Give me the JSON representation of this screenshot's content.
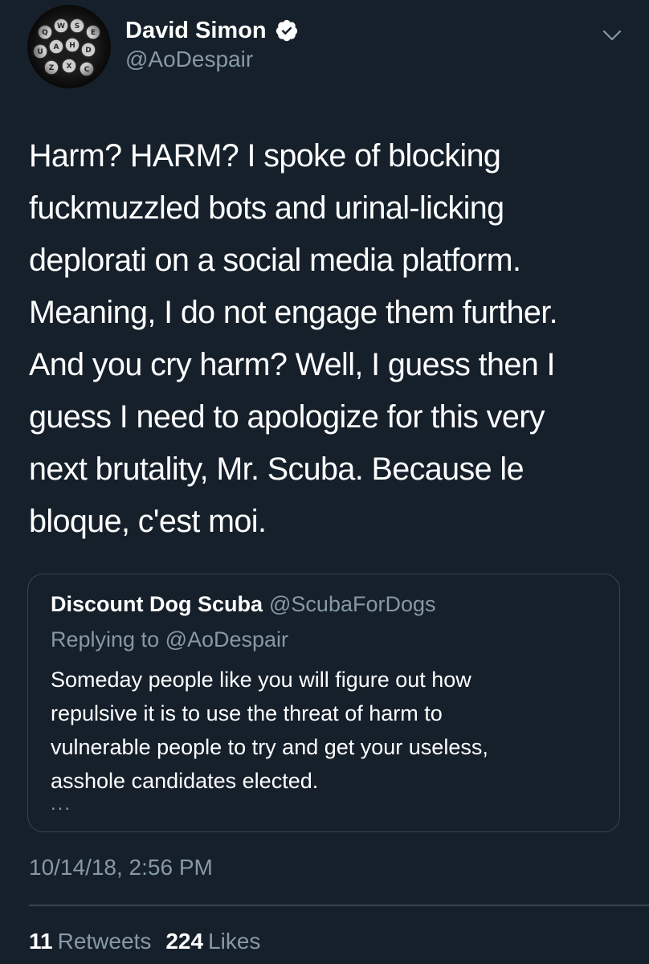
{
  "author": {
    "name": "David Simon",
    "handle": "@AoDespair",
    "verified": true,
    "avatar_icon": "typewriter-keys-avatar"
  },
  "tweet": {
    "text": "Harm? HARM? I spoke of blocking\nfuckmuzzled bots and urinal-licking\ndeplorati on a social media platform.\nMeaning, I do not engage them further.\nAnd you cry harm? Well, I guess then I\nguess I need to apologize for this very\nnext brutality, Mr. Scuba. Because le\nbloque, c'est moi.",
    "timestamp": "10/14/18, 2:56 PM"
  },
  "quoted_tweet": {
    "name": "Discount Dog Scuba",
    "handle": "@ScubaForDogs",
    "replying_to": "Replying to @AoDespair",
    "text": "Someday people like you will figure out how\nrepulsive it is to use the threat of harm to\nvulnerable people to try and get your useless,\nasshole candidates elected.",
    "ellipsis": "..."
  },
  "stats": {
    "retweets_count": "11",
    "retweets_label": "Retweets",
    "likes_count": "224",
    "likes_label": "Likes"
  },
  "colors": {
    "background": "#15202b",
    "secondary_text": "#8899a6",
    "border": "#38444d",
    "verified_badge": "#ffffff"
  }
}
